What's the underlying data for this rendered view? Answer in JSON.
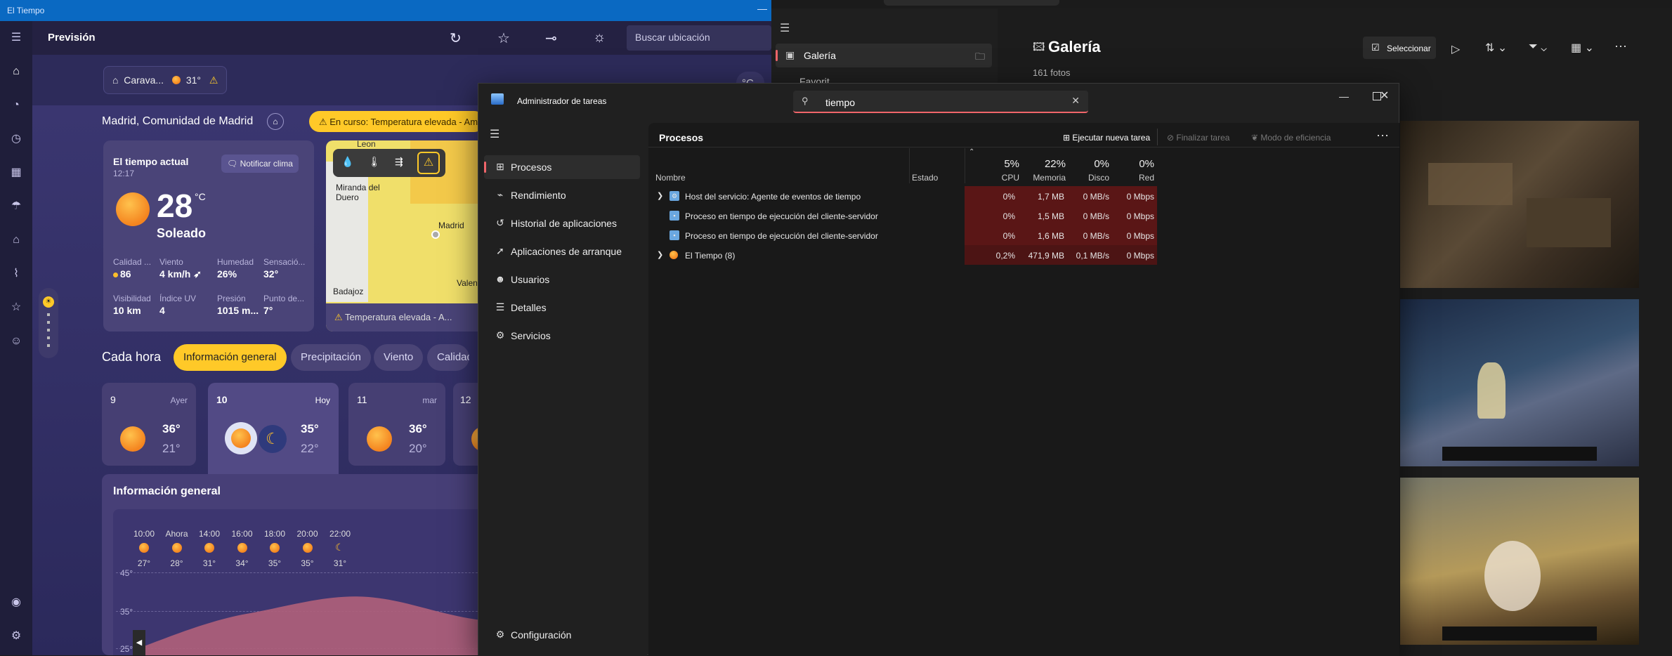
{
  "weather": {
    "window_title": "El Tiempo",
    "header_title": "Previsión",
    "search_placeholder": "Buscar ubicación",
    "unit_toggle": "°C",
    "location_pill": {
      "name": "Carava...",
      "temp": "31°",
      "alert": "⚠"
    },
    "location_full": "Madrid, Comunidad de Madrid",
    "alert_banner": "⚠ En curso: Temperatura elevada - Amari",
    "current": {
      "title": "El tiempo actual",
      "time": "12:17",
      "notify": "Notificar clima",
      "temp": "28",
      "unit": "°C",
      "condition": "Soleado",
      "details": [
        {
          "label": "Calidad ...",
          "value": "86"
        },
        {
          "label": "Viento",
          "value": "4 km/h"
        },
        {
          "label": "Humedad",
          "value": "26%"
        },
        {
          "label": "Sensació...",
          "value": "32°"
        },
        {
          "label": "Visibilidad",
          "value": "10 km"
        },
        {
          "label": "Índice UV",
          "value": "4"
        },
        {
          "label": "Presión",
          "value": "1015 m..."
        },
        {
          "label": "Punto de...",
          "value": "7°"
        }
      ]
    },
    "map": {
      "places": [
        "Leon",
        "Miranda del Duero",
        "Madrid",
        "Badajoz",
        "Valen"
      ],
      "warning": "Temperatura elevada - A..."
    },
    "hourly_title": "Cada hora",
    "chips": [
      "Información general",
      "Precipitación",
      "Viento",
      "Calidad d"
    ],
    "days": [
      {
        "day": "9",
        "label": "Ayer",
        "hi": "36°",
        "lo": "21°"
      },
      {
        "day": "10",
        "label": "Hoy",
        "hi": "35°",
        "lo": "22°"
      },
      {
        "day": "11",
        "label": "mar",
        "hi": "36°",
        "lo": "20°"
      },
      {
        "day": "12",
        "label": "",
        "hi": "",
        "lo": ""
      }
    ],
    "overview_title": "Información general",
    "hours": [
      {
        "time": "10:00",
        "temp": "27°"
      },
      {
        "time": "Ahora",
        "temp": "28°"
      },
      {
        "time": "14:00",
        "temp": "31°"
      },
      {
        "time": "16:00",
        "temp": "34°"
      },
      {
        "time": "18:00",
        "temp": "35°"
      },
      {
        "time": "20:00",
        "temp": "35°"
      },
      {
        "time": "22:00",
        "temp": "31°"
      }
    ],
    "y_axis": [
      "45°",
      "35°",
      "25°"
    ]
  },
  "gallery": {
    "nav_item": "Galería",
    "nav_item2": "Favorit...",
    "title": "Galería",
    "count": "161 fotos",
    "select_button": "Seleccionar"
  },
  "taskmanager": {
    "title": "Administrador de tareas",
    "search_value": "tiempo",
    "nav": [
      "Procesos",
      "Rendimiento",
      "Historial de aplicaciones",
      "Aplicaciones de arranque",
      "Usuarios",
      "Detalles",
      "Servicios"
    ],
    "settings": "Configuración",
    "page_title": "Procesos",
    "run_task": "Ejecutar nueva tarea",
    "end_task": "Finalizar tarea",
    "efficiency": "Modo de eficiencia",
    "columns": {
      "name": "Nombre",
      "status": "Estado",
      "cpu_pct": "5%",
      "cpu": "CPU",
      "mem_pct": "22%",
      "mem": "Memoria",
      "disk_pct": "0%",
      "disk": "Disco",
      "net_pct": "0%",
      "net": "Red"
    },
    "rows": [
      {
        "name": "Host del servicio: Agente de eventos de tiempo",
        "cpu": "0%",
        "mem": "1,7 MB",
        "disk": "0 MB/s",
        "net": "0 Mbps"
      },
      {
        "name": "Proceso en tiempo de ejecución del cliente-servidor",
        "cpu": "0%",
        "mem": "1,5 MB",
        "disk": "0 MB/s",
        "net": "0 Mbps"
      },
      {
        "name": "Proceso en tiempo de ejecución del cliente-servidor",
        "cpu": "0%",
        "mem": "1,6 MB",
        "disk": "0 MB/s",
        "net": "0 Mbps"
      },
      {
        "name": "El Tiempo (8)",
        "cpu": "0,2%",
        "mem": "471,9 MB",
        "disk": "0,1 MB/s",
        "net": "0 Mbps"
      }
    ]
  }
}
